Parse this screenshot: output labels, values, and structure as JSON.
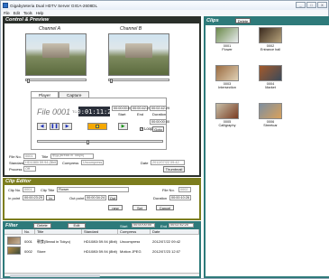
{
  "window": {
    "title": "Gigabyteteria Dual HDTV Server GIGA-2608DL",
    "controls": [
      "_",
      "□",
      "X"
    ]
  },
  "menu": [
    "File",
    "Edit",
    "Tools",
    "Help"
  ],
  "control_preview": {
    "header": "Control & Preview",
    "channel_a": "Channel A",
    "channel_b": "Channel B",
    "tabs": [
      "Player",
      "Capture"
    ],
    "file_label": "File 0001",
    "timecode_prefix": "TM",
    "timecode": "00:01:11:29",
    "start_value": "00:00:00:00",
    "start_label": "Start",
    "end_value": "00:00:42:20",
    "end_label": "End",
    "duration_value": "00:02:42:29",
    "duration_label": "Duration",
    "goto_value": "00:00:00:00",
    "goto_label": "Goto",
    "loop_label": "Loop",
    "loop_checked": true,
    "file_no_label": "File No.",
    "file_no_value": "0001",
    "title_label": "Title",
    "title_value": "朝食(Bread in Tokyo)",
    "standard_label": "Standard",
    "standard_value": "HD1080i 59.94 (Bbit)",
    "compress_label": "Compress",
    "compress_value": "Uncompress",
    "date_label": "Date",
    "date_value": "2012/07/22 09:42",
    "process_label": "Process",
    "process_value": "Off",
    "thumbnail_label": "Thumbnail"
  },
  "clips": {
    "header": "Clips",
    "delete_label": "Delete",
    "items": [
      {
        "no": "0001",
        "name": "Flower",
        "colors": [
          "#6b8a4a",
          "#e9ecef"
        ]
      },
      {
        "no": "0002",
        "name": "Entrance hall",
        "colors": [
          "#3a2a1e",
          "#b7a37c"
        ]
      },
      {
        "no": "0003",
        "name": "Intersection",
        "colors": [
          "#9b6b40",
          "#e0d1b6"
        ]
      },
      {
        "no": "0004",
        "name": "Market",
        "colors": [
          "#a35a2b",
          "#3c4a5a"
        ]
      },
      {
        "no": "0005",
        "name": "Calligraphy",
        "colors": [
          "#c7bfa8",
          "#7a3c22"
        ]
      },
      {
        "no": "0006",
        "name": "Streetcar",
        "colors": [
          "#7e8fa0",
          "#d9a15a"
        ]
      }
    ]
  },
  "clip_editor": {
    "header": "Clip Editor",
    "clip_no_label": "Clip No.",
    "clip_no_value": "0001",
    "clip_title_label": "Clip Title",
    "clip_title_value": "Flower",
    "file_no_label": "File No.",
    "file_no_value": "0002",
    "in_point_label": "In point",
    "in_point_value": "00:00:23:29",
    "in_button": "In",
    "out_point_label": "Out point",
    "out_point_value": "00:00:34:24",
    "out_button": "Out",
    "duration_label": "Duration",
    "duration_value": "00:00:10:26",
    "new_label": "new",
    "set_label": "Set",
    "cancel_label": "Cancel"
  },
  "filter": {
    "header": "Filter",
    "delete_label": "Delete",
    "edit_label": "Edit",
    "start_label": "Start",
    "start_value": "00:00:00:00",
    "end_label": "End",
    "end_value": "00:02:42:20",
    "columns": [
      "No.",
      "Title",
      "Standard",
      "Compress",
      "Date"
    ],
    "rows": [
      {
        "no": "0001",
        "title": "朝食(Bread in Tokyo)",
        "standard": "HD1080i 59.94 (8bit)",
        "compress": "Uncompress",
        "date": "2012/07/22 09:42",
        "colors": [
          "#8a6d4b",
          "#c9b39a"
        ]
      },
      {
        "no": "0002",
        "title": "Store",
        "standard": "HD1080i 59.94 (8bit)",
        "compress": "Motion JPEG",
        "date": "2012/07/23 12:07",
        "colors": [
          "#b88c44",
          "#3b4a3a"
        ]
      }
    ]
  }
}
